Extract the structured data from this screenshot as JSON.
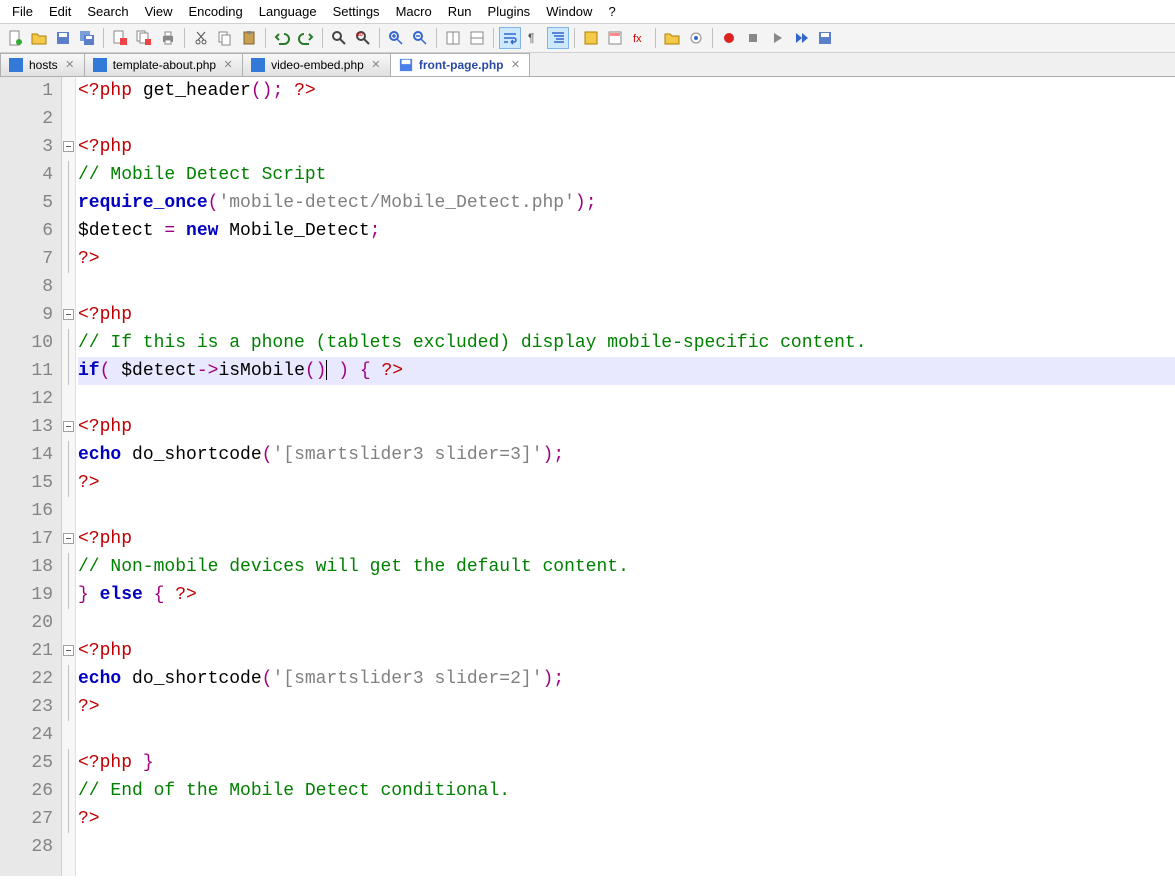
{
  "menu": {
    "items": [
      "File",
      "Edit",
      "Search",
      "View",
      "Encoding",
      "Language",
      "Settings",
      "Macro",
      "Run",
      "Plugins",
      "Window",
      "?"
    ]
  },
  "toolbar": {
    "groups": [
      [
        "new",
        "open",
        "save",
        "save-all"
      ],
      [
        "close",
        "close-all",
        "print"
      ],
      [
        "cut",
        "copy",
        "paste"
      ],
      [
        "undo",
        "redo"
      ],
      [
        "find",
        "replace"
      ],
      [
        "zoom-in",
        "zoom-out"
      ],
      [
        "sync-v",
        "sync-h"
      ],
      [
        "wrap",
        "all-chars",
        "indent-guide"
      ],
      [
        "lang",
        "doc-map",
        "func-list"
      ],
      [
        "folder",
        "monitor"
      ],
      [
        "rec",
        "stop",
        "play",
        "play-multi",
        "save-macro"
      ]
    ],
    "pressed": [
      "wrap",
      "indent-guide"
    ]
  },
  "tabs": [
    {
      "label": "hosts",
      "active": false
    },
    {
      "label": "template-about.php",
      "active": false
    },
    {
      "label": "video-embed.php",
      "active": false
    },
    {
      "label": "front-page.php",
      "active": true
    }
  ],
  "editor": {
    "line_count": 28,
    "current_line": 11,
    "fold_open": [
      3,
      9,
      13,
      17,
      21
    ],
    "fold_continue": [
      4,
      5,
      6,
      7,
      10,
      11,
      14,
      15,
      18,
      19,
      22,
      23,
      25,
      26,
      27
    ],
    "alt_lines": [
      3,
      5,
      7,
      9,
      11,
      13,
      15,
      17,
      19,
      21,
      23,
      25,
      27
    ],
    "lines": {
      "1": [
        [
          "c-tag",
          "<?php"
        ],
        [
          "c-func",
          " get_header"
        ],
        [
          "c-br",
          "()"
        ],
        [
          "c-op",
          ";"
        ],
        [
          "c-tag",
          " ?>"
        ]
      ],
      "2": [],
      "3": [
        [
          "c-tag",
          "<?php"
        ]
      ],
      "4": [
        [
          "c-cmt",
          "// Mobile Detect Script"
        ]
      ],
      "5": [
        [
          "c-kw",
          "require_once"
        ],
        [
          "c-br",
          "("
        ],
        [
          "c-str",
          "'mobile-detect/Mobile_Detect.php'"
        ],
        [
          "c-br",
          ")"
        ],
        [
          "c-op",
          ";"
        ]
      ],
      "6": [
        [
          "c-var",
          "$detect"
        ],
        [
          "c-op",
          " = "
        ],
        [
          "c-kw",
          "new"
        ],
        [
          "c-var",
          " Mobile_Detect"
        ],
        [
          "c-op",
          ";"
        ]
      ],
      "7": [
        [
          "c-tag",
          "?>"
        ]
      ],
      "8": [],
      "9": [
        [
          "c-tag",
          "<?php"
        ]
      ],
      "10": [
        [
          "c-cmt",
          "// If this is a phone (tablets excluded) display mobile-specific content."
        ]
      ],
      "11": [
        [
          "c-kw",
          "if"
        ],
        [
          "c-br",
          "("
        ],
        [
          "c-var",
          " $detect"
        ],
        [
          "c-op",
          "->"
        ],
        [
          "c-var",
          "isMobile"
        ],
        [
          "c-br",
          "()"
        ],
        [
          "caret",
          ""
        ],
        [
          "c-br",
          " )"
        ],
        [
          "c-op",
          " { "
        ],
        [
          "c-tag",
          "?>"
        ]
      ],
      "12": [],
      "13": [
        [
          "c-tag",
          "<?php"
        ]
      ],
      "14": [
        [
          "c-kw",
          "echo"
        ],
        [
          "c-func",
          " do_shortcode"
        ],
        [
          "c-br",
          "("
        ],
        [
          "c-str",
          "'[smartslider3 slider=3]'"
        ],
        [
          "c-br",
          ")"
        ],
        [
          "c-op",
          ";"
        ]
      ],
      "15": [
        [
          "c-tag",
          "?>"
        ]
      ],
      "16": [],
      "17": [
        [
          "c-tag",
          "<?php"
        ]
      ],
      "18": [
        [
          "c-cmt",
          "// Non-mobile devices will get the default content."
        ]
      ],
      "19": [
        [
          "c-op",
          "} "
        ],
        [
          "c-kw",
          "else"
        ],
        [
          "c-op",
          " { "
        ],
        [
          "c-tag",
          "?>"
        ]
      ],
      "20": [],
      "21": [
        [
          "c-tag",
          "<?php"
        ]
      ],
      "22": [
        [
          "c-kw",
          "echo"
        ],
        [
          "c-func",
          " do_shortcode"
        ],
        [
          "c-br",
          "("
        ],
        [
          "c-str",
          "'[smartslider3 slider=2]'"
        ],
        [
          "c-br",
          ")"
        ],
        [
          "c-op",
          ";"
        ]
      ],
      "23": [
        [
          "c-tag",
          "?>"
        ]
      ],
      "24": [],
      "25": [
        [
          "c-tag",
          "<?php "
        ],
        [
          "c-op",
          "}"
        ]
      ],
      "26": [
        [
          "c-cmt",
          "// End of the Mobile Detect conditional."
        ]
      ],
      "27": [
        [
          "c-tag",
          "?>"
        ]
      ],
      "28": []
    }
  }
}
